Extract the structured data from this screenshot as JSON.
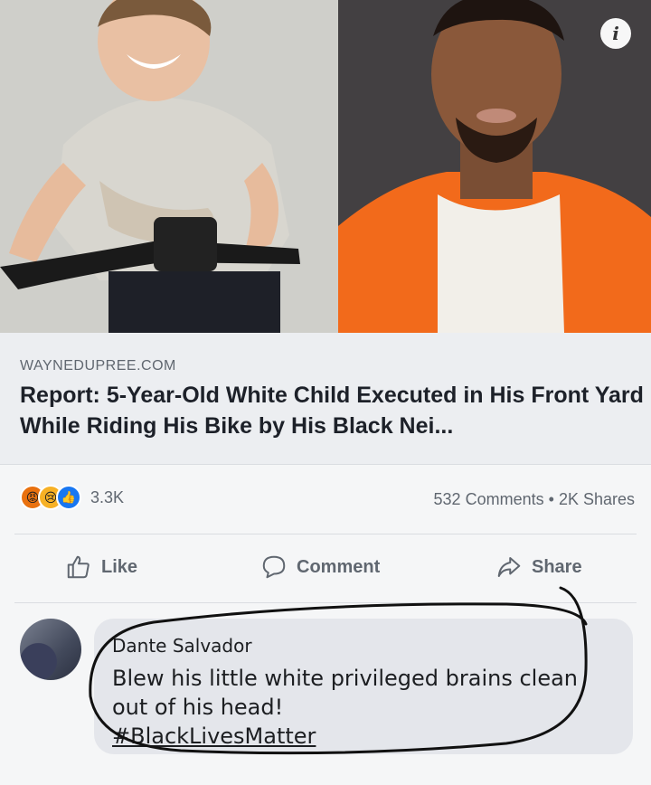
{
  "post": {
    "info_symbol": "i",
    "link": {
      "domain": "WAYNEDUPREE.COM",
      "title": "Report: 5-Year-Old White Child Executed in His Front Yard While Riding His Bike by His Black Nei..."
    },
    "reactions": {
      "icons": [
        "angry-icon",
        "sad-icon",
        "like-icon"
      ],
      "count": "3.3K"
    },
    "stats": {
      "comments": "532 Comments",
      "separator": "•",
      "shares": "2K Shares"
    },
    "actions": {
      "like_label": "Like",
      "comment_label": "Comment",
      "share_label": "Share"
    }
  },
  "comment": {
    "author": "Dante Salvador",
    "text": "Blew his little white privileged brains clean out of his head!",
    "hashtag": "#BlackLivesMatter"
  },
  "colors": {
    "brand_blue": "#1877f2",
    "angry": "#e9710f",
    "sad": "#f7b125",
    "prison_orange": "#f26a1b"
  }
}
